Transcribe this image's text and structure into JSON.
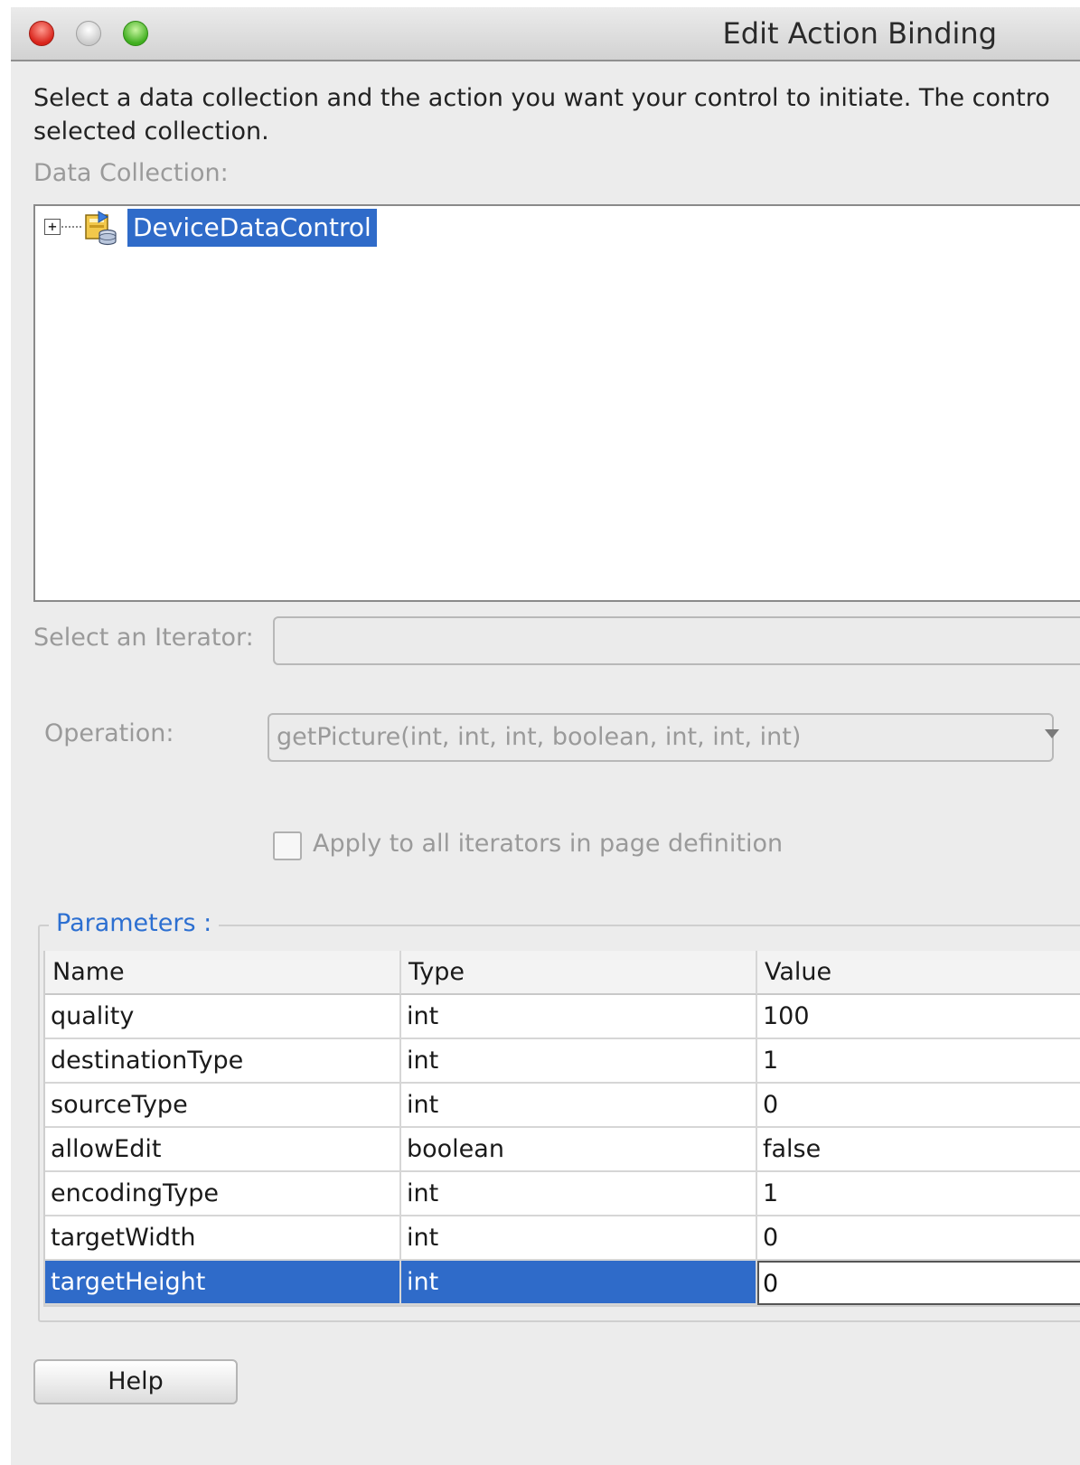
{
  "window": {
    "title": "Edit Action Binding"
  },
  "description": {
    "line1": "Select a data collection and the action you want your control to initiate. The contro",
    "line2": "selected collection."
  },
  "data_collection": {
    "label": "Data Collection:",
    "tree": [
      {
        "label": "DeviceDataControl",
        "selected": true,
        "icon": "data-control-icon"
      }
    ]
  },
  "iterator": {
    "label": "Select an Iterator:",
    "value": ""
  },
  "operation": {
    "label": "Operation:",
    "value": "getPicture(int, int, int, boolean, int, int, int)"
  },
  "apply_all": {
    "label": "Apply to all iterators in page definition",
    "checked": false
  },
  "parameters": {
    "legend": "Parameters :",
    "columns": [
      "Name",
      "Type",
      "Value"
    ],
    "rows": [
      {
        "name": "quality",
        "type": "int",
        "value": "100"
      },
      {
        "name": "destinationType",
        "type": "int",
        "value": "1"
      },
      {
        "name": "sourceType",
        "type": "int",
        "value": "0"
      },
      {
        "name": "allowEdit",
        "type": "boolean",
        "value": "false"
      },
      {
        "name": "encodingType",
        "type": "int",
        "value": "1"
      },
      {
        "name": "targetWidth",
        "type": "int",
        "value": "0"
      },
      {
        "name": "targetHeight",
        "type": "int",
        "value": "0",
        "selected": true
      }
    ]
  },
  "buttons": {
    "help": "Help"
  },
  "colors": {
    "selection": "#2f6bc9",
    "legend": "#2c6fd1",
    "disabled_text": "#9a9a9a"
  }
}
